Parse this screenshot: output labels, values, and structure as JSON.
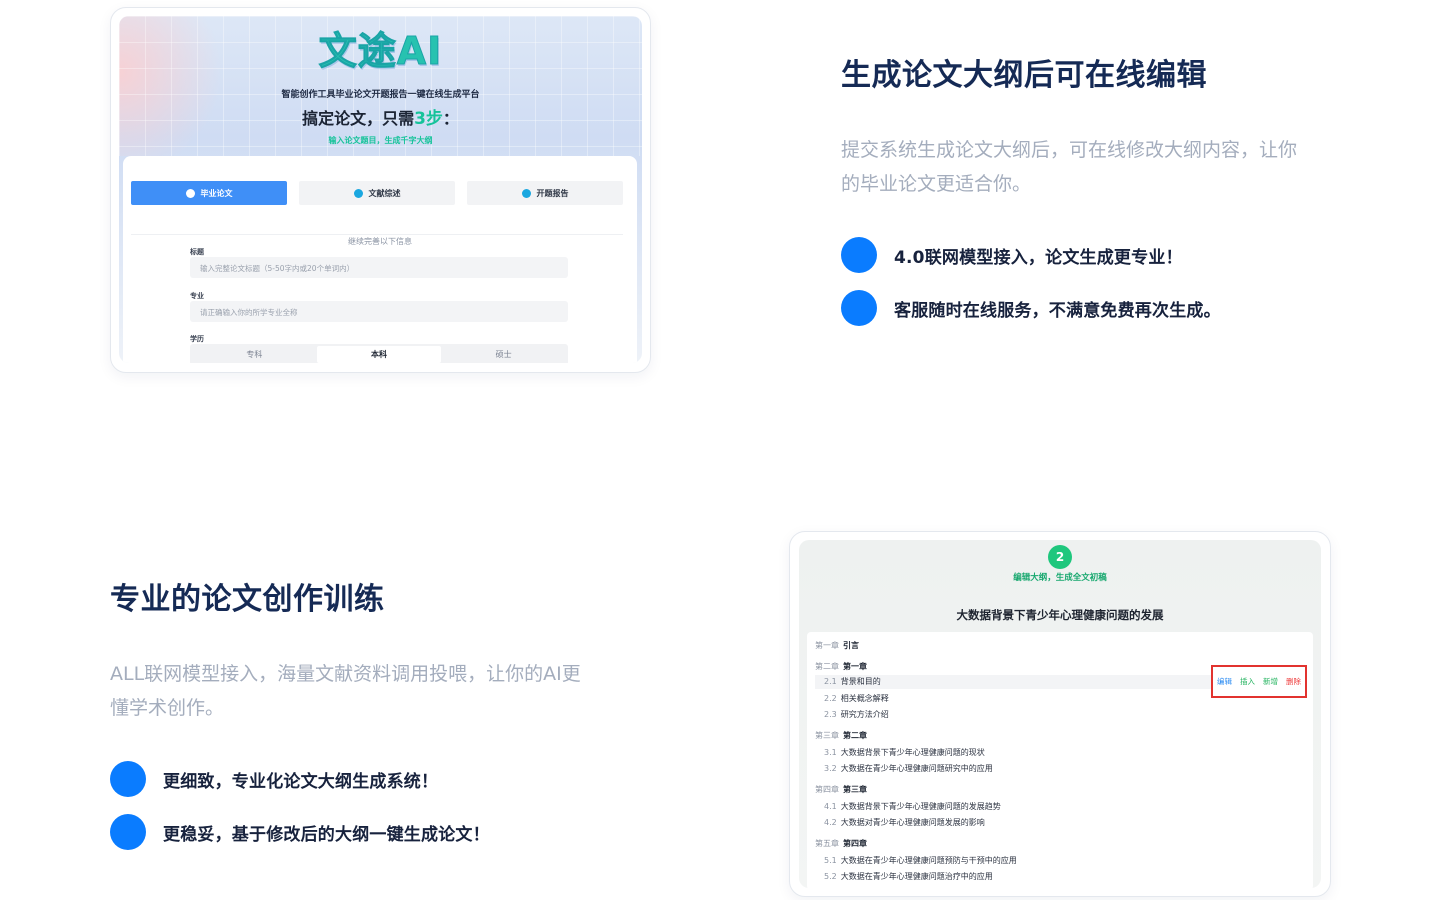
{
  "feature1": {
    "title": "生成论文大纲后可在线编辑",
    "desc_line1": "提交系统生成论文大纲后，可在线修改大纲内容，让你",
    "desc_line2": "的毕业论文更适合你。",
    "bullets": [
      "4.0联网模型接入，论文生成更专业！",
      "客服随时在线服务，不满意免费再次生成。"
    ]
  },
  "feature2": {
    "title": "专业的论文创作训练",
    "desc_line1": "ALL联网模型接入，海量文献资料调用投喂，让你的AI更",
    "desc_line2": "懂学术创作。",
    "bullets": [
      "更细致，专业化论文大纲生成系统！",
      "更稳妥，基于修改后的大纲一键生成论文！"
    ]
  },
  "shot1": {
    "logo": "文途AI",
    "tagline": "智能创作工具毕业论文开题报告一键在线生成平台",
    "slogan_prefix": "搞定论文，只需",
    "slogan_highlight": "3步",
    "slogan_suffix": "：",
    "subslogan": "输入论文题目，生成千字大纲",
    "tabs": [
      "毕业论文",
      "文献综述",
      "开题报告"
    ],
    "divider_text": "继续完善以下信息",
    "fields": {
      "title_label": "标题",
      "title_placeholder": "输入完整论文标题（5-50字内或20个单词内）",
      "major_label": "专业",
      "major_placeholder": "请正确输入你的所学专业全称",
      "degree_label": "学历",
      "degree_options": [
        "专科",
        "本科",
        "硕士"
      ],
      "degree_selected": "本科"
    },
    "colors": {
      "accent_green": "#16c39a",
      "tab_active": "#3f8ff7"
    }
  },
  "shot2": {
    "step_number": "2",
    "step_label": "编辑大纲，生成全文初稿",
    "doc_title": "大数据背景下青少年心理健康问题的发展",
    "outline": {
      "ch1": {
        "num": "第一章",
        "title": "引言"
      },
      "ch2": {
        "num": "第二章",
        "title": "第一章",
        "sections": [
          {
            "num": "2.1",
            "title": "背景和目的"
          },
          {
            "num": "2.2",
            "title": "相关概念解释"
          },
          {
            "num": "2.3",
            "title": "研究方法介绍"
          }
        ]
      },
      "ch3": {
        "num": "第三章",
        "title": "第二章",
        "sections": [
          {
            "num": "3.1",
            "title": "大数据背景下青少年心理健康问题的现状"
          },
          {
            "num": "3.2",
            "title": "大数据在青少年心理健康问题研究中的应用"
          }
        ]
      },
      "ch4": {
        "num": "第四章",
        "title": "第三章",
        "sections": [
          {
            "num": "4.1",
            "title": "大数据背景下青少年心理健康问题的发展趋势"
          },
          {
            "num": "4.2",
            "title": "大数据对青少年心理健康问题发展的影响"
          }
        ]
      },
      "ch5": {
        "num": "第五章",
        "title": "第四章",
        "sections": [
          {
            "num": "5.1",
            "title": "大数据在青少年心理健康问题预防与干预中的应用"
          },
          {
            "num": "5.2",
            "title": "大数据在青少年心理健康问题治疗中的应用"
          }
        ]
      }
    },
    "row_actions": {
      "edit": "编辑",
      "insert": "插入",
      "add": "新增",
      "delete": "删除"
    },
    "colors": {
      "step_green": "#1ec77d",
      "action_border": "#e2332f"
    }
  },
  "colors": {
    "title": "#152a55",
    "bullet_dot": "#0a7cff",
    "desc": "#a4adbd"
  }
}
